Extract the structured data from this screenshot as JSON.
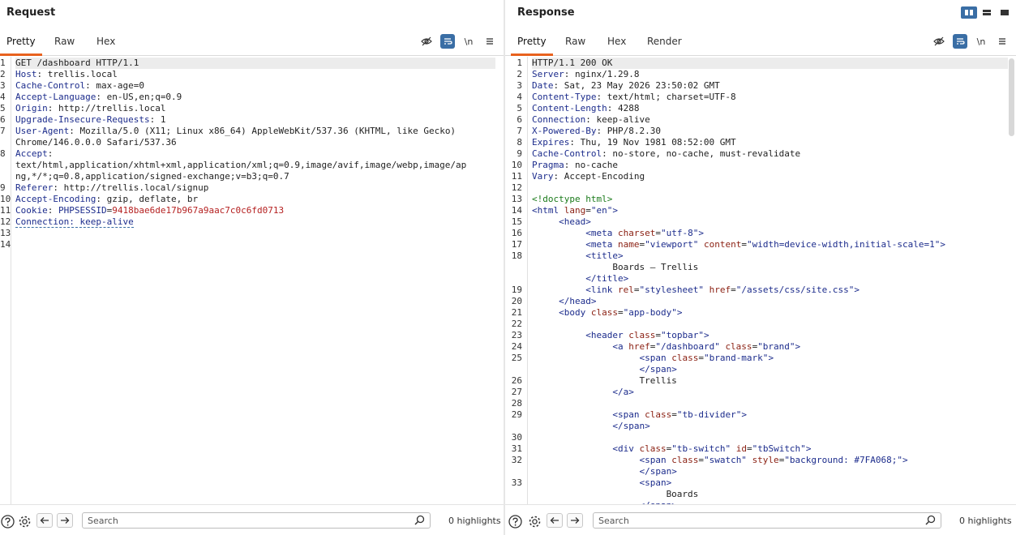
{
  "request": {
    "title": "Request",
    "tabs": [
      "Pretty",
      "Raw",
      "Hex"
    ],
    "active_tab": "Pretty",
    "newline_tool": "\\n",
    "lines": [
      {
        "n": "1",
        "parts": [
          [
            "v",
            "GET /dashboard HTTP/1.1"
          ]
        ]
      },
      {
        "n": "2",
        "parts": [
          [
            "k",
            "Host"
          ],
          [
            "v",
            ": trellis.local"
          ]
        ]
      },
      {
        "n": "3",
        "parts": [
          [
            "k",
            "Cache-Control"
          ],
          [
            "v",
            ": max-age=0"
          ]
        ]
      },
      {
        "n": "4",
        "parts": [
          [
            "k",
            "Accept-Language"
          ],
          [
            "v",
            ": en-US,en;q=0.9"
          ]
        ]
      },
      {
        "n": "5",
        "parts": [
          [
            "k",
            "Origin"
          ],
          [
            "v",
            ": http://trellis.local"
          ]
        ]
      },
      {
        "n": "6",
        "parts": [
          [
            "k",
            "Upgrade-Insecure-Requests"
          ],
          [
            "v",
            ": 1"
          ]
        ]
      },
      {
        "n": "7",
        "parts": [
          [
            "k",
            "User-Agent"
          ],
          [
            "v",
            ": Mozilla/5.0 (X11; Linux x86_64) AppleWebKit/537.36 (KHTML, like Gecko)"
          ]
        ]
      },
      {
        "n": "",
        "parts": [
          [
            "v",
            "Chrome/146.0.0.0 Safari/537.36"
          ]
        ]
      },
      {
        "n": "8",
        "parts": [
          [
            "k",
            "Accept"
          ],
          [
            "v",
            ":"
          ]
        ]
      },
      {
        "n": "",
        "parts": [
          [
            "v",
            "text/html,application/xhtml+xml,application/xml;q=0.9,image/avif,image/webp,image/ap"
          ]
        ]
      },
      {
        "n": "",
        "parts": [
          [
            "v",
            "ng,*/*;q=0.8,application/signed-exchange;v=b3;q=0.7"
          ]
        ]
      },
      {
        "n": "9",
        "parts": [
          [
            "k",
            "Referer"
          ],
          [
            "v",
            ": http://trellis.local/signup"
          ]
        ]
      },
      {
        "n": "10",
        "parts": [
          [
            "k",
            "Accept-Encoding"
          ],
          [
            "v",
            ": gzip, deflate, br"
          ]
        ]
      },
      {
        "n": "11",
        "parts": [
          [
            "k",
            "Cookie"
          ],
          [
            "v",
            ": "
          ],
          [
            "cookie-k",
            "PHPSESSID"
          ],
          [
            "v",
            "="
          ],
          [
            "cookie-v",
            "9418bae6de17b967a9aac7c0c6fd0713"
          ]
        ]
      },
      {
        "n": "12",
        "parts": [
          [
            "conn",
            "Connection: keep-alive"
          ]
        ]
      },
      {
        "n": "13",
        "parts": []
      },
      {
        "n": "14",
        "parts": []
      }
    ],
    "search_placeholder": "Search",
    "highlights": "0 highlights"
  },
  "response": {
    "title": "Response",
    "tabs": [
      "Pretty",
      "Raw",
      "Hex",
      "Render"
    ],
    "active_tab": "Pretty",
    "newline_tool": "\\n",
    "lines": [
      {
        "n": "1",
        "parts": [
          [
            "v",
            "HTTP/1.1 200 OK"
          ]
        ]
      },
      {
        "n": "2",
        "parts": [
          [
            "k",
            "Server"
          ],
          [
            "v",
            ": nginx/1.29.8"
          ]
        ]
      },
      {
        "n": "3",
        "parts": [
          [
            "k",
            "Date"
          ],
          [
            "v",
            ": Sat, 23 May 2026 23:50:02 GMT"
          ]
        ]
      },
      {
        "n": "4",
        "parts": [
          [
            "k",
            "Content-Type"
          ],
          [
            "v",
            ": text/html; charset=UTF-8"
          ]
        ]
      },
      {
        "n": "5",
        "parts": [
          [
            "k",
            "Content-Length"
          ],
          [
            "v",
            ": 4288"
          ]
        ]
      },
      {
        "n": "6",
        "parts": [
          [
            "k",
            "Connection"
          ],
          [
            "v",
            ": keep-alive"
          ]
        ]
      },
      {
        "n": "7",
        "parts": [
          [
            "k",
            "X-Powered-By"
          ],
          [
            "v",
            ": PHP/8.2.30"
          ]
        ]
      },
      {
        "n": "8",
        "parts": [
          [
            "k",
            "Expires"
          ],
          [
            "v",
            ": Thu, 19 Nov 1981 08:52:00 GMT"
          ]
        ]
      },
      {
        "n": "9",
        "parts": [
          [
            "k",
            "Cache-Control"
          ],
          [
            "v",
            ": no-store, no-cache, must-revalidate"
          ]
        ]
      },
      {
        "n": "10",
        "parts": [
          [
            "k",
            "Pragma"
          ],
          [
            "v",
            ": no-cache"
          ]
        ]
      },
      {
        "n": "11",
        "parts": [
          [
            "k",
            "Vary"
          ],
          [
            "v",
            ": Accept-Encoding"
          ]
        ]
      },
      {
        "n": "12",
        "parts": []
      },
      {
        "n": "13",
        "parts": [
          [
            "doctype",
            "<!doctype html>"
          ]
        ]
      },
      {
        "n": "14",
        "parts": [
          [
            "tag",
            "<html "
          ],
          [
            "attr",
            "lang"
          ],
          [
            "v",
            "="
          ],
          [
            "str",
            "\"en\""
          ],
          [
            "tag",
            ">"
          ]
        ]
      },
      {
        "n": "15",
        "parts": [
          [
            "v",
            "     "
          ],
          [
            "tag",
            "<head>"
          ]
        ]
      },
      {
        "n": "16",
        "parts": [
          [
            "v",
            "          "
          ],
          [
            "tag",
            "<meta "
          ],
          [
            "attr",
            "charset"
          ],
          [
            "v",
            "="
          ],
          [
            "str",
            "\"utf-8\""
          ],
          [
            "tag",
            ">"
          ]
        ]
      },
      {
        "n": "17",
        "parts": [
          [
            "v",
            "          "
          ],
          [
            "tag",
            "<meta "
          ],
          [
            "attr",
            "name"
          ],
          [
            "v",
            "="
          ],
          [
            "str",
            "\"viewport\" "
          ],
          [
            "attr",
            "content"
          ],
          [
            "v",
            "="
          ],
          [
            "str",
            "\"width=device-width,initial-scale=1\""
          ],
          [
            "tag",
            ">"
          ]
        ]
      },
      {
        "n": "18",
        "parts": [
          [
            "v",
            "          "
          ],
          [
            "tag",
            "<title>"
          ]
        ]
      },
      {
        "n": "",
        "parts": [
          [
            "v",
            "               Boards — Trellis"
          ]
        ]
      },
      {
        "n": "",
        "parts": [
          [
            "v",
            "          "
          ],
          [
            "tag",
            "</title>"
          ]
        ]
      },
      {
        "n": "19",
        "parts": [
          [
            "v",
            "          "
          ],
          [
            "tag",
            "<link "
          ],
          [
            "attr",
            "rel"
          ],
          [
            "v",
            "="
          ],
          [
            "str",
            "\"stylesheet\" "
          ],
          [
            "attr",
            "href"
          ],
          [
            "v",
            "="
          ],
          [
            "str",
            "\"/assets/css/site.css\""
          ],
          [
            "tag",
            ">"
          ]
        ]
      },
      {
        "n": "20",
        "parts": [
          [
            "v",
            "     "
          ],
          [
            "tag",
            "</head>"
          ]
        ]
      },
      {
        "n": "21",
        "parts": [
          [
            "v",
            "     "
          ],
          [
            "tag",
            "<body "
          ],
          [
            "attr",
            "class"
          ],
          [
            "v",
            "="
          ],
          [
            "str",
            "\"app-body\""
          ],
          [
            "tag",
            ">"
          ]
        ]
      },
      {
        "n": "22",
        "parts": []
      },
      {
        "n": "23",
        "parts": [
          [
            "v",
            "          "
          ],
          [
            "tag",
            "<header "
          ],
          [
            "attr",
            "class"
          ],
          [
            "v",
            "="
          ],
          [
            "str",
            "\"topbar\""
          ],
          [
            "tag",
            ">"
          ]
        ]
      },
      {
        "n": "24",
        "parts": [
          [
            "v",
            "               "
          ],
          [
            "tag",
            "<a "
          ],
          [
            "attr",
            "href"
          ],
          [
            "v",
            "="
          ],
          [
            "str",
            "\"/dashboard\" "
          ],
          [
            "attr",
            "class"
          ],
          [
            "v",
            "="
          ],
          [
            "str",
            "\"brand\""
          ],
          [
            "tag",
            ">"
          ]
        ]
      },
      {
        "n": "25",
        "parts": [
          [
            "v",
            "                    "
          ],
          [
            "tag",
            "<span "
          ],
          [
            "attr",
            "class"
          ],
          [
            "v",
            "="
          ],
          [
            "str",
            "\"brand-mark\""
          ],
          [
            "tag",
            ">"
          ]
        ]
      },
      {
        "n": "",
        "parts": [
          [
            "v",
            "                    "
          ],
          [
            "tag",
            "</span>"
          ]
        ]
      },
      {
        "n": "26",
        "parts": [
          [
            "v",
            "                    Trellis"
          ]
        ]
      },
      {
        "n": "27",
        "parts": [
          [
            "v",
            "               "
          ],
          [
            "tag",
            "</a>"
          ]
        ]
      },
      {
        "n": "28",
        "parts": []
      },
      {
        "n": "29",
        "parts": [
          [
            "v",
            "               "
          ],
          [
            "tag",
            "<span "
          ],
          [
            "attr",
            "class"
          ],
          [
            "v",
            "="
          ],
          [
            "str",
            "\"tb-divider\""
          ],
          [
            "tag",
            ">"
          ]
        ]
      },
      {
        "n": "",
        "parts": [
          [
            "v",
            "               "
          ],
          [
            "tag",
            "</span>"
          ]
        ]
      },
      {
        "n": "30",
        "parts": []
      },
      {
        "n": "31",
        "parts": [
          [
            "v",
            "               "
          ],
          [
            "tag",
            "<div "
          ],
          [
            "attr",
            "class"
          ],
          [
            "v",
            "="
          ],
          [
            "str",
            "\"tb-switch\" "
          ],
          [
            "attr",
            "id"
          ],
          [
            "v",
            "="
          ],
          [
            "str",
            "\"tbSwitch\""
          ],
          [
            "tag",
            ">"
          ]
        ]
      },
      {
        "n": "32",
        "parts": [
          [
            "v",
            "                    "
          ],
          [
            "tag",
            "<span "
          ],
          [
            "attr",
            "class"
          ],
          [
            "v",
            "="
          ],
          [
            "str",
            "\"swatch\" "
          ],
          [
            "attr",
            "style"
          ],
          [
            "v",
            "="
          ],
          [
            "str",
            "\"background: #7FA068;\""
          ],
          [
            "tag",
            ">"
          ]
        ]
      },
      {
        "n": "",
        "parts": [
          [
            "v",
            "                    "
          ],
          [
            "tag",
            "</span>"
          ]
        ]
      },
      {
        "n": "33",
        "parts": [
          [
            "v",
            "                    "
          ],
          [
            "tag",
            "<span>"
          ]
        ]
      },
      {
        "n": "",
        "parts": [
          [
            "v",
            "                         Boards"
          ]
        ]
      },
      {
        "n": "",
        "parts": [
          [
            "v",
            "                    "
          ],
          [
            "tag",
            "</span>"
          ]
        ]
      }
    ],
    "search_placeholder": "Search",
    "highlights": "0 highlights"
  },
  "colors": {
    "accent_tab": "#e8621e",
    "tool_active": "#3a6ea5"
  }
}
